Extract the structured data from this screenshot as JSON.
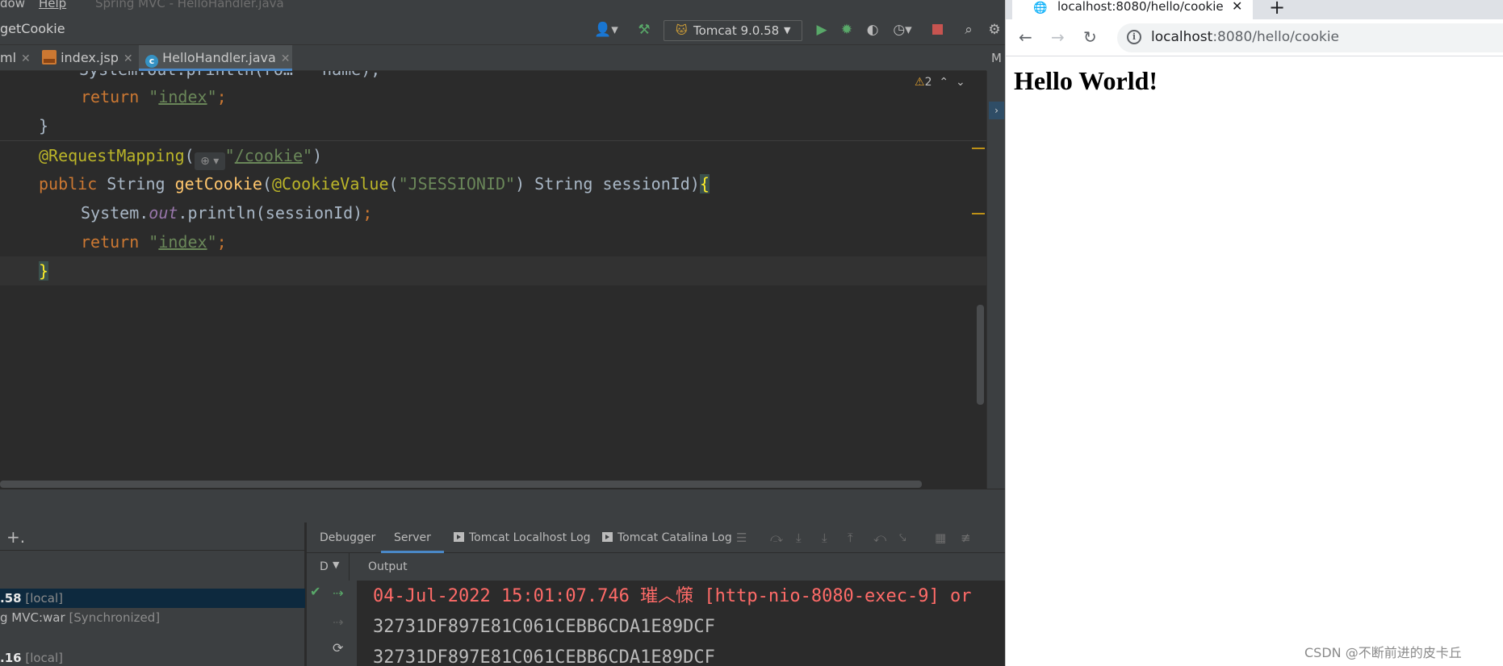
{
  "ide": {
    "menu": {
      "window": "dow",
      "help": "Help",
      "title": "Spring MVC - HelloHandler.java"
    },
    "breadcrumb": "getCookie",
    "run_config": "Tomcat 9.0.58",
    "tabs": [
      {
        "label": "ml"
      },
      {
        "label": "index.jsp"
      },
      {
        "label": "HelloHandler.java"
      }
    ],
    "right_tab": "M",
    "warnings": "2",
    "code": {
      "l1_partial": "System.out.println(ro…   name);",
      "return_kw": "return",
      "index_str": "index",
      "close_brace": "}",
      "mapping_ann": "@RequestMapping",
      "mapping_path": "/cookie",
      "public_kw": "public",
      "string_type": "String",
      "method_name": "getCookie",
      "cookie_ann": "@CookieValue",
      "cookie_name": "JSESSIONID",
      "param": "String sessionId",
      "open_brace": "{",
      "system": "System.",
      "out": "out",
      "println": ".println(sessionId)",
      "semicolon": ";"
    },
    "services": {
      "tree": [
        {
          "name": ".58",
          "tag": "[local]"
        },
        {
          "name": "g MVC:war",
          "tag": "[Synchronized]"
        },
        {
          "name": ".16",
          "tag": "[local]"
        }
      ],
      "tabs": [
        "Debugger",
        "Server",
        "Tomcat Localhost Log",
        "Tomcat Catalina Log"
      ],
      "deploy_col": "D",
      "output_col": "Output",
      "output": [
        "04-Jul-2022 15:01:07.746 璀︿憡 [http-nio-8080-exec-9] or",
        "32731DF897E81C061CEBB6CDA1E89DCF",
        "32731DF897E81C061CEBB6CDA1E89DCF"
      ]
    }
  },
  "browser": {
    "tab_title": "localhost:8080/hello/cookie",
    "url_host": "localhost",
    "url_rest": ":8080/hello/cookie",
    "heading": "Hello World!"
  },
  "watermark": "CSDN @不断前进的皮卡丘",
  "colors": {
    "keyword": "#cc7832",
    "string": "#6a8759",
    "annotation": "#bbb529",
    "method": "#ffc66d",
    "error_log": "#ff6b68",
    "accent": "#4a88c7"
  }
}
